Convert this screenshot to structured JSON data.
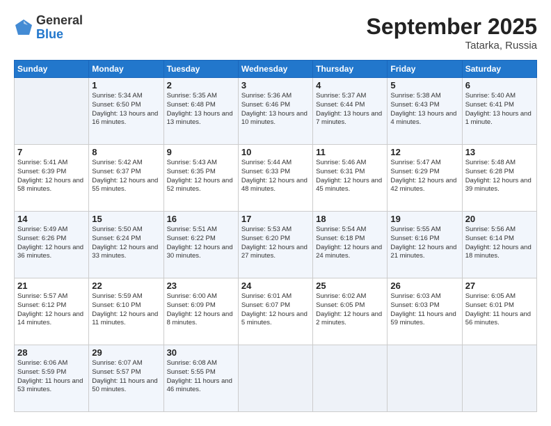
{
  "header": {
    "logo": {
      "line1": "General",
      "line2": "Blue"
    },
    "title": "September 2025",
    "subtitle": "Tatarka, Russia"
  },
  "days_of_week": [
    "Sunday",
    "Monday",
    "Tuesday",
    "Wednesday",
    "Thursday",
    "Friday",
    "Saturday"
  ],
  "weeks": [
    [
      {
        "day": "",
        "sunrise": "",
        "sunset": "",
        "daylight": ""
      },
      {
        "day": "1",
        "sunrise": "Sunrise: 5:34 AM",
        "sunset": "Sunset: 6:50 PM",
        "daylight": "Daylight: 13 hours and 16 minutes."
      },
      {
        "day": "2",
        "sunrise": "Sunrise: 5:35 AM",
        "sunset": "Sunset: 6:48 PM",
        "daylight": "Daylight: 13 hours and 13 minutes."
      },
      {
        "day": "3",
        "sunrise": "Sunrise: 5:36 AM",
        "sunset": "Sunset: 6:46 PM",
        "daylight": "Daylight: 13 hours and 10 minutes."
      },
      {
        "day": "4",
        "sunrise": "Sunrise: 5:37 AM",
        "sunset": "Sunset: 6:44 PM",
        "daylight": "Daylight: 13 hours and 7 minutes."
      },
      {
        "day": "5",
        "sunrise": "Sunrise: 5:38 AM",
        "sunset": "Sunset: 6:43 PM",
        "daylight": "Daylight: 13 hours and 4 minutes."
      },
      {
        "day": "6",
        "sunrise": "Sunrise: 5:40 AM",
        "sunset": "Sunset: 6:41 PM",
        "daylight": "Daylight: 13 hours and 1 minute."
      }
    ],
    [
      {
        "day": "7",
        "sunrise": "Sunrise: 5:41 AM",
        "sunset": "Sunset: 6:39 PM",
        "daylight": "Daylight: 12 hours and 58 minutes."
      },
      {
        "day": "8",
        "sunrise": "Sunrise: 5:42 AM",
        "sunset": "Sunset: 6:37 PM",
        "daylight": "Daylight: 12 hours and 55 minutes."
      },
      {
        "day": "9",
        "sunrise": "Sunrise: 5:43 AM",
        "sunset": "Sunset: 6:35 PM",
        "daylight": "Daylight: 12 hours and 52 minutes."
      },
      {
        "day": "10",
        "sunrise": "Sunrise: 5:44 AM",
        "sunset": "Sunset: 6:33 PM",
        "daylight": "Daylight: 12 hours and 48 minutes."
      },
      {
        "day": "11",
        "sunrise": "Sunrise: 5:46 AM",
        "sunset": "Sunset: 6:31 PM",
        "daylight": "Daylight: 12 hours and 45 minutes."
      },
      {
        "day": "12",
        "sunrise": "Sunrise: 5:47 AM",
        "sunset": "Sunset: 6:29 PM",
        "daylight": "Daylight: 12 hours and 42 minutes."
      },
      {
        "day": "13",
        "sunrise": "Sunrise: 5:48 AM",
        "sunset": "Sunset: 6:28 PM",
        "daylight": "Daylight: 12 hours and 39 minutes."
      }
    ],
    [
      {
        "day": "14",
        "sunrise": "Sunrise: 5:49 AM",
        "sunset": "Sunset: 6:26 PM",
        "daylight": "Daylight: 12 hours and 36 minutes."
      },
      {
        "day": "15",
        "sunrise": "Sunrise: 5:50 AM",
        "sunset": "Sunset: 6:24 PM",
        "daylight": "Daylight: 12 hours and 33 minutes."
      },
      {
        "day": "16",
        "sunrise": "Sunrise: 5:51 AM",
        "sunset": "Sunset: 6:22 PM",
        "daylight": "Daylight: 12 hours and 30 minutes."
      },
      {
        "day": "17",
        "sunrise": "Sunrise: 5:53 AM",
        "sunset": "Sunset: 6:20 PM",
        "daylight": "Daylight: 12 hours and 27 minutes."
      },
      {
        "day": "18",
        "sunrise": "Sunrise: 5:54 AM",
        "sunset": "Sunset: 6:18 PM",
        "daylight": "Daylight: 12 hours and 24 minutes."
      },
      {
        "day": "19",
        "sunrise": "Sunrise: 5:55 AM",
        "sunset": "Sunset: 6:16 PM",
        "daylight": "Daylight: 12 hours and 21 minutes."
      },
      {
        "day": "20",
        "sunrise": "Sunrise: 5:56 AM",
        "sunset": "Sunset: 6:14 PM",
        "daylight": "Daylight: 12 hours and 18 minutes."
      }
    ],
    [
      {
        "day": "21",
        "sunrise": "Sunrise: 5:57 AM",
        "sunset": "Sunset: 6:12 PM",
        "daylight": "Daylight: 12 hours and 14 minutes."
      },
      {
        "day": "22",
        "sunrise": "Sunrise: 5:59 AM",
        "sunset": "Sunset: 6:10 PM",
        "daylight": "Daylight: 12 hours and 11 minutes."
      },
      {
        "day": "23",
        "sunrise": "Sunrise: 6:00 AM",
        "sunset": "Sunset: 6:09 PM",
        "daylight": "Daylight: 12 hours and 8 minutes."
      },
      {
        "day": "24",
        "sunrise": "Sunrise: 6:01 AM",
        "sunset": "Sunset: 6:07 PM",
        "daylight": "Daylight: 12 hours and 5 minutes."
      },
      {
        "day": "25",
        "sunrise": "Sunrise: 6:02 AM",
        "sunset": "Sunset: 6:05 PM",
        "daylight": "Daylight: 12 hours and 2 minutes."
      },
      {
        "day": "26",
        "sunrise": "Sunrise: 6:03 AM",
        "sunset": "Sunset: 6:03 PM",
        "daylight": "Daylight: 11 hours and 59 minutes."
      },
      {
        "day": "27",
        "sunrise": "Sunrise: 6:05 AM",
        "sunset": "Sunset: 6:01 PM",
        "daylight": "Daylight: 11 hours and 56 minutes."
      }
    ],
    [
      {
        "day": "28",
        "sunrise": "Sunrise: 6:06 AM",
        "sunset": "Sunset: 5:59 PM",
        "daylight": "Daylight: 11 hours and 53 minutes."
      },
      {
        "day": "29",
        "sunrise": "Sunrise: 6:07 AM",
        "sunset": "Sunset: 5:57 PM",
        "daylight": "Daylight: 11 hours and 50 minutes."
      },
      {
        "day": "30",
        "sunrise": "Sunrise: 6:08 AM",
        "sunset": "Sunset: 5:55 PM",
        "daylight": "Daylight: 11 hours and 46 minutes."
      },
      {
        "day": "",
        "sunrise": "",
        "sunset": "",
        "daylight": ""
      },
      {
        "day": "",
        "sunrise": "",
        "sunset": "",
        "daylight": ""
      },
      {
        "day": "",
        "sunrise": "",
        "sunset": "",
        "daylight": ""
      },
      {
        "day": "",
        "sunrise": "",
        "sunset": "",
        "daylight": ""
      }
    ]
  ]
}
